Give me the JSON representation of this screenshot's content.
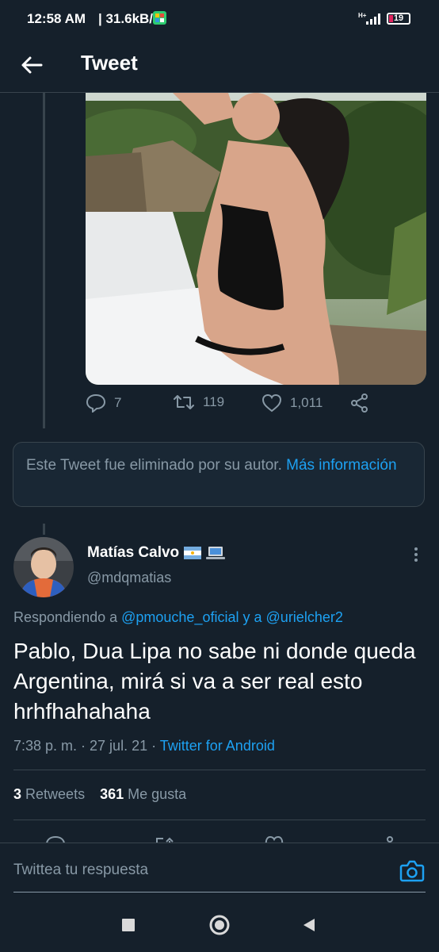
{
  "status_bar": {
    "time": "12:58 AM",
    "speed": "| 31.6kB/s",
    "network": "H+",
    "battery": "19"
  },
  "header": {
    "title": "Tweet",
    "back_icon": "arrow-left-icon"
  },
  "quoted_tweet": {
    "image": "photo",
    "replies": "7",
    "retweets": "119",
    "likes": "1,011"
  },
  "deleted_notice": {
    "text": "Este Tweet fue eliminado por su autor.",
    "link": "Más información"
  },
  "tweet": {
    "name": "Matías Calvo",
    "handle": "@mdqmatias",
    "replying_prefix": "Respondiendo a",
    "mention1": "@pmouche_oficial",
    "replying_mid": "y a",
    "mention2": "@urielcher2",
    "text": "Pablo, Dua Lipa no sabe ni donde queda Argentina, mirá si va a ser real esto hrhfhahahaha",
    "time_date": "7:38 p. m. · 27 jul. 21 ·",
    "client": "Twitter for Android",
    "retweets_count": "3",
    "retweets_label": "Retweets",
    "likes_count": "361",
    "likes_label": "Me gusta"
  },
  "reply_box": {
    "placeholder": "Twittea tu respuesta"
  },
  "colors": {
    "background": "#15202b",
    "accent": "#1da1f2",
    "secondary_text": "#8899a6",
    "border": "#38444d"
  }
}
